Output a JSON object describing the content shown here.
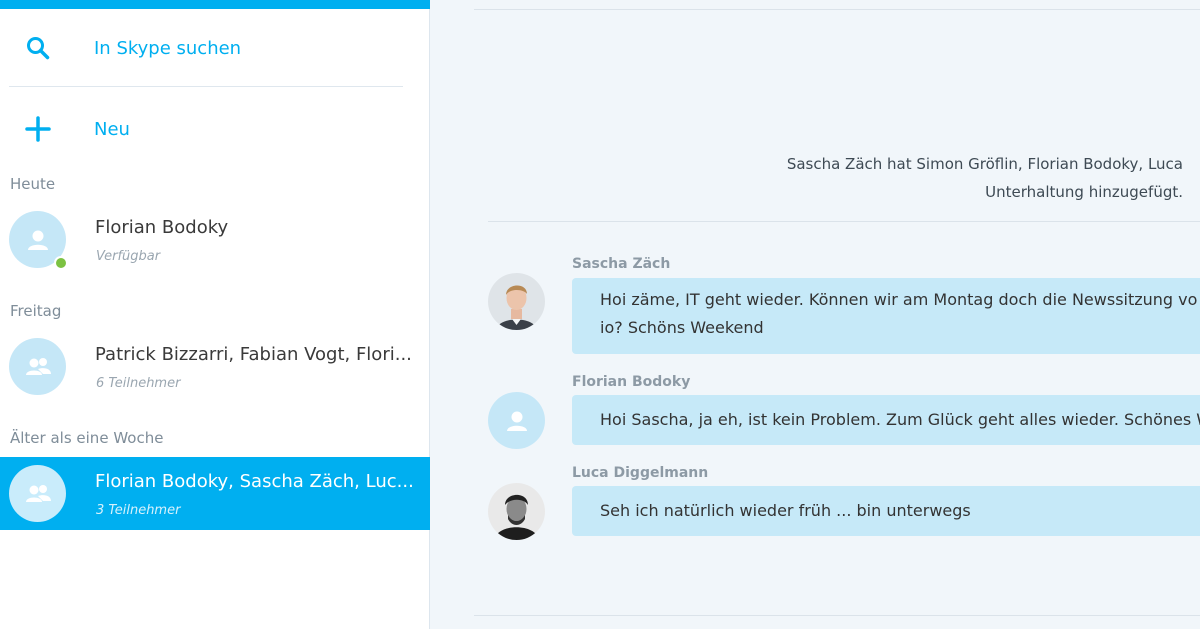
{
  "sidebar": {
    "search_label": "In Skype suchen",
    "new_label": "Neu",
    "sections": [
      {
        "label": "Heute",
        "conversations": [
          {
            "name": "Florian Bodoky",
            "subtitle": "Verfügbar"
          }
        ]
      },
      {
        "label": "Freitag",
        "conversations": [
          {
            "name": "Patrick Bizzarri, Fabian Vogt, Flori...",
            "subtitle": "6 Teilnehmer"
          }
        ]
      },
      {
        "label": "Älter als eine Woche",
        "conversations": [
          {
            "name": "Florian Bodoky, Sascha Zäch, Luc...",
            "subtitle": "3 Teilnehmer"
          }
        ]
      }
    ]
  },
  "chat": {
    "system_message_line1": "Sascha Zäch hat Simon Gröflin, Florian Bodoky, Luca",
    "system_message_line2": "Unterhaltung hinzugefügt.",
    "messages": [
      {
        "author": "Sascha Zäch",
        "line1": "Hoi zäme, IT geht wieder. Können wir am Montag doch die Newssitzung vo",
        "line2": "io? Schöns Weekend"
      },
      {
        "author": "Florian Bodoky",
        "line1": "Hoi Sascha,  ja eh, ist kein Problem. Zum Glück geht alles wieder. Schönes W"
      },
      {
        "author": "Luca Diggelmann",
        "line1": "Seh ich natürlich wieder früh ... bin unterwegs"
      }
    ]
  },
  "colors": {
    "accent": "#00aff0",
    "presence_available": "#7cc242",
    "bubble": "#c6e9f8",
    "avatar_placeholder": "#c5e7f7"
  },
  "icons": {
    "search": "search-icon",
    "new": "plus-icon",
    "contact": "person-icon",
    "group": "group-icon"
  }
}
